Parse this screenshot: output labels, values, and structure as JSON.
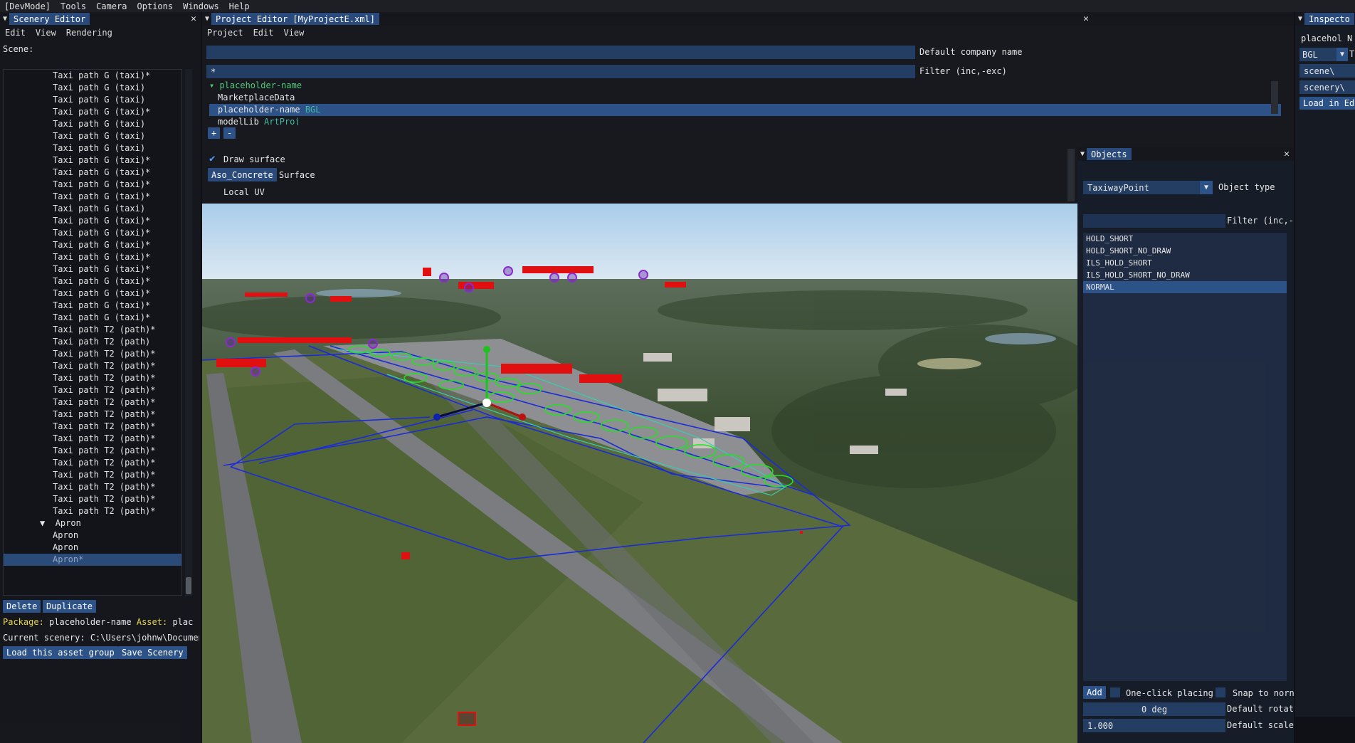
{
  "menubar": [
    "[DevMode]",
    "Tools",
    "Camera",
    "Options",
    "Windows",
    "Help"
  ],
  "scenery_editor": {
    "title": "Scenery Editor",
    "menu": [
      "Edit",
      "View",
      "Rendering"
    ],
    "scene_label": "Scene:",
    "items": [
      "Taxi path G (taxi)*",
      "Taxi path G (taxi)",
      "Taxi path G (taxi)",
      "Taxi path G (taxi)*",
      "Taxi path G (taxi)",
      "Taxi path G (taxi)",
      "Taxi path G (taxi)",
      "Taxi path G (taxi)*",
      "Taxi path G (taxi)*",
      "Taxi path G (taxi)*",
      "Taxi path G (taxi)*",
      "Taxi path G (taxi)",
      "Taxi path G (taxi)*",
      "Taxi path G (taxi)*",
      "Taxi path G (taxi)*",
      "Taxi path G (taxi)*",
      "Taxi path G (taxi)*",
      "Taxi path G (taxi)*",
      "Taxi path G (taxi)*",
      "Taxi path G (taxi)*",
      "Taxi path G (taxi)*",
      "Taxi path T2 (path)*",
      "Taxi path T2 (path)",
      "Taxi path T2 (path)*",
      "Taxi path T2 (path)*",
      "Taxi path T2 (path)*",
      "Taxi path T2 (path)*",
      "Taxi path T2 (path)*",
      "Taxi path T2 (path)*",
      "Taxi path T2 (path)*",
      "Taxi path T2 (path)*",
      "Taxi path T2 (path)*",
      "Taxi path T2 (path)*",
      "Taxi path T2 (path)*",
      "Taxi path T2 (path)*",
      "Taxi path T2 (path)*",
      "Taxi path T2 (path)*"
    ],
    "group": "Apron",
    "group_children": [
      "Apron",
      "Apron"
    ],
    "selected_item": "Apron*",
    "delete_label": "Delete",
    "duplicate_label": "Duplicate",
    "package_label": "Package:",
    "package_value": "placeholder-name",
    "asset_label": "Asset:",
    "asset_value": "plac",
    "current_scenery_label": "Current scenery:",
    "current_scenery_value": "C:\\Users\\johnw\\Documen",
    "load_asset_group_label": "Load this asset group",
    "save_scenery_label": "Save Scenery"
  },
  "project_editor": {
    "title": "Project Editor [MyProjectE.xml]",
    "menu": [
      "Project",
      "Edit",
      "View"
    ],
    "company_field_value": "",
    "company_label": "Default company name",
    "filter_field_value": "*",
    "filter_label": "Filter (inc,-exc)",
    "tree_root": "placeholder-name",
    "tree_items": [
      {
        "label": "MarketplaceData",
        "tag": ""
      },
      {
        "label": "placeholder-name",
        "tag": "BGL"
      },
      {
        "label": "modelLib",
        "tag": "ArtProj"
      }
    ],
    "add_label": "+",
    "remove_label": "-"
  },
  "surface_panel": {
    "draw_surface_label": "Draw surface",
    "material_value": "Aso_Concrete",
    "surface_label": "Surface",
    "local_uv_label": "Local UV"
  },
  "objects_panel": {
    "title": "Objects",
    "object_type_value": "TaxiwayPoint",
    "object_type_label": "Object type",
    "filter_value": "",
    "filter_label": "Filter (inc,-",
    "items": [
      "HOLD_SHORT",
      "HOLD_SHORT_NO_DRAW",
      "ILS_HOLD_SHORT",
      "ILS_HOLD_SHORT_NO_DRAW",
      "NORMAL"
    ],
    "selected": "NORMAL",
    "add_label": "Add",
    "one_click_label": "One-click placing",
    "snap_label": "Snap to norn",
    "rotation_value": "0 deg",
    "rotation_label": "Default rotat",
    "scale_value": "1.000",
    "scale_label": "Default scale"
  },
  "inspector": {
    "title": "Inspecto",
    "name_value": "placehol N",
    "type_value": "BGL",
    "type_label": "Ty",
    "scene_value": "scene\\",
    "scenery_value": "scenery\\",
    "load_label": "Load in Ed"
  },
  "colors": {
    "accent": "#2c5288",
    "tab_blue": "#294a7a",
    "field_blue": "#243e63",
    "tree_green": "#4fc97a",
    "taxi_blue": "#1a2bd8",
    "apron_green": "#22e022",
    "marker_red": "#e01010",
    "marker_purple": "#8a2bd0"
  }
}
